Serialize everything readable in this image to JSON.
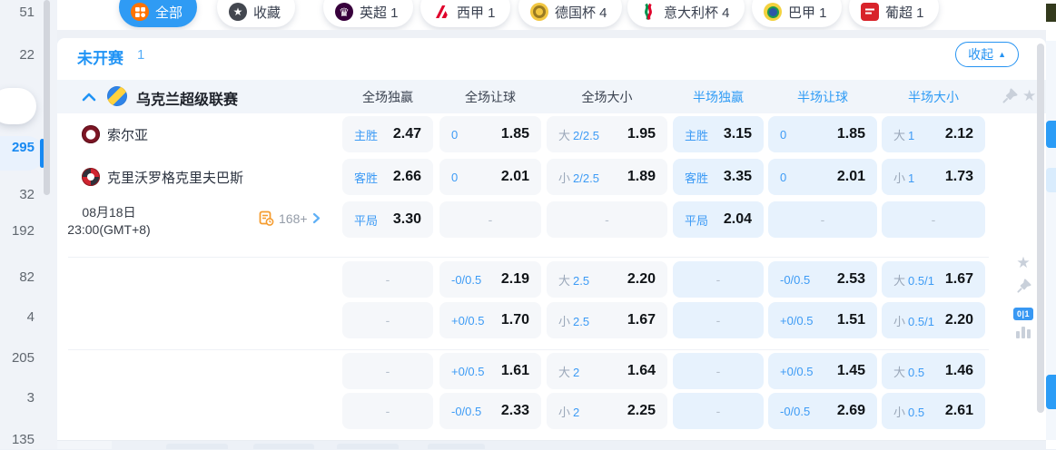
{
  "dash": "-",
  "colors": {
    "accent": "#2f9bf4",
    "cell_full_bg": "#f5f7fa",
    "cell_half_bg": "#e7f2fd",
    "odds_label_blue": "#3d9bf5",
    "odds_value": "#101418",
    "selected_sidebar": "#1789f2"
  },
  "sidebar": {
    "counts": [
      "51",
      "22",
      "295",
      "32",
      "192",
      "82",
      "4",
      "205",
      "3",
      "135"
    ],
    "selected_index": 2
  },
  "tabs": [
    {
      "key": "all",
      "label": "全部",
      "icon": "grid-icon",
      "selected": true
    },
    {
      "key": "favorites",
      "label": "收藏",
      "icon": "star-circle-icon",
      "selected": false
    },
    {
      "key": "premier-league",
      "label": "英超 1",
      "icon": "premier-league-icon",
      "selected": false
    },
    {
      "key": "laliga",
      "label": "西甲 1",
      "icon": "laliga-icon",
      "selected": false
    },
    {
      "key": "german-cup",
      "label": "德国杯 4",
      "icon": "german-cup-icon",
      "selected": false
    },
    {
      "key": "coppa-italia",
      "label": "意大利杯 4",
      "icon": "italy-cup-icon",
      "selected": false
    },
    {
      "key": "brasileirao",
      "label": "巴甲 1",
      "icon": "brazil-serie-a-icon",
      "selected": false
    },
    {
      "key": "liga-portugal",
      "label": "葡超 1",
      "icon": "portugal-league-icon",
      "selected": false
    }
  ],
  "section": {
    "status_label": "未开赛",
    "count": "1",
    "collapse_label": "收起"
  },
  "league": {
    "name": "乌克兰超级联赛",
    "headers": [
      "全场独赢",
      "全场让球",
      "全场大小",
      "半场独赢",
      "半场让球",
      "半场大小"
    ]
  },
  "match": {
    "home_team": "索尔亚",
    "away_team": "克里沃罗格克里夫巴斯",
    "date": "08月18日",
    "time": "23:00(GMT+8)",
    "markets_count": "168+",
    "corner_badge": "0|1"
  },
  "odds_rows": [
    {
      "kind": "home",
      "cells": [
        {
          "label": "主胜",
          "value": "2.47"
        },
        {
          "label": "0",
          "value": "1.85"
        },
        {
          "prefix": "大",
          "label": "2/2.5",
          "value": "1.95"
        },
        {
          "label": "主胜",
          "value": "3.15"
        },
        {
          "label": "0",
          "value": "1.85"
        },
        {
          "prefix": "大",
          "label": "1",
          "value": "2.12"
        }
      ]
    },
    {
      "kind": "away",
      "cells": [
        {
          "label": "客胜",
          "value": "2.66"
        },
        {
          "label": "0",
          "value": "2.01"
        },
        {
          "prefix": "小",
          "label": "2/2.5",
          "value": "1.89"
        },
        {
          "label": "客胜",
          "value": "3.35"
        },
        {
          "label": "0",
          "value": "2.01"
        },
        {
          "prefix": "小",
          "label": "1",
          "value": "1.73"
        }
      ]
    },
    {
      "kind": "date",
      "cells": [
        {
          "label": "平局",
          "value": "3.30"
        },
        {
          "dash": true
        },
        {
          "dash": true
        },
        {
          "label": "平局",
          "value": "2.04"
        },
        {
          "dash": true
        },
        {
          "dash": true
        }
      ]
    },
    {
      "kind": "plain",
      "cells": [
        {
          "dash": true
        },
        {
          "label": "-0/0.5",
          "value": "2.19"
        },
        {
          "prefix": "大",
          "label": "2.5",
          "value": "2.20"
        },
        {
          "dash": true
        },
        {
          "label": "-0/0.5",
          "value": "2.53"
        },
        {
          "prefix": "大",
          "label": "0.5/1",
          "value": "1.67"
        }
      ]
    },
    {
      "kind": "plain",
      "cells": [
        {
          "dash": true
        },
        {
          "label": "+0/0.5",
          "value": "1.70"
        },
        {
          "prefix": "小",
          "label": "2.5",
          "value": "1.67"
        },
        {
          "dash": true
        },
        {
          "label": "+0/0.5",
          "value": "1.51"
        },
        {
          "prefix": "小",
          "label": "0.5/1",
          "value": "2.20"
        }
      ]
    },
    {
      "kind": "plain",
      "cells": [
        {
          "dash": true
        },
        {
          "label": "+0/0.5",
          "value": "1.61"
        },
        {
          "prefix": "大",
          "label": "2",
          "value": "1.64"
        },
        {
          "dash": true
        },
        {
          "label": "+0/0.5",
          "value": "1.45"
        },
        {
          "prefix": "大",
          "label": "0.5",
          "value": "1.46"
        }
      ]
    },
    {
      "kind": "plain",
      "cells": [
        {
          "dash": true
        },
        {
          "label": "-0/0.5",
          "value": "2.33"
        },
        {
          "prefix": "小",
          "label": "2",
          "value": "2.25"
        },
        {
          "dash": true
        },
        {
          "label": "-0/0.5",
          "value": "2.69"
        },
        {
          "prefix": "小",
          "label": "0.5",
          "value": "2.61"
        }
      ]
    }
  ]
}
